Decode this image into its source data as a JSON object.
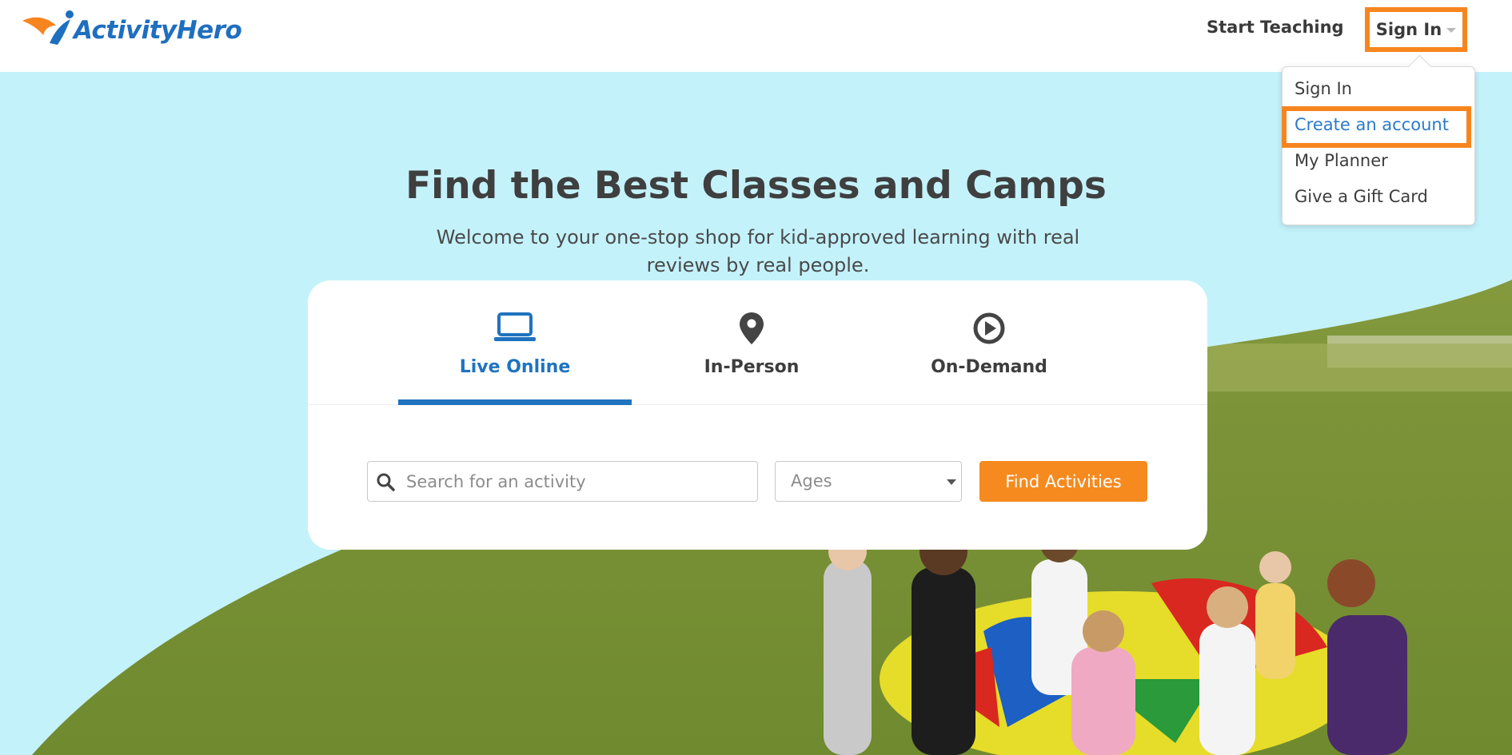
{
  "brand": {
    "name": "ActivityHero",
    "primary_color": "#1f6fbf",
    "accent_color": "#f68a1f"
  },
  "nav": {
    "start_teaching": "Start Teaching",
    "sign_in": "Sign In"
  },
  "dropdown": {
    "items": [
      {
        "label": "Sign In"
      },
      {
        "label": "Create an account"
      },
      {
        "label": "My Planner"
      },
      {
        "label": "Give a Gift Card"
      }
    ]
  },
  "hero": {
    "title": "Find the Best Classes and Camps",
    "subtitle": "Welcome to your one-stop shop for kid-approved learning with real reviews by real people."
  },
  "tabs": [
    {
      "label": "Live Online",
      "icon": "laptop-icon"
    },
    {
      "label": "In-Person",
      "icon": "map-pin-icon"
    },
    {
      "label": "On-Demand",
      "icon": "play-circle-icon"
    }
  ],
  "search": {
    "placeholder": "Search for an activity",
    "value": "",
    "ages_label": "Ages",
    "button_label": "Find Activities"
  }
}
